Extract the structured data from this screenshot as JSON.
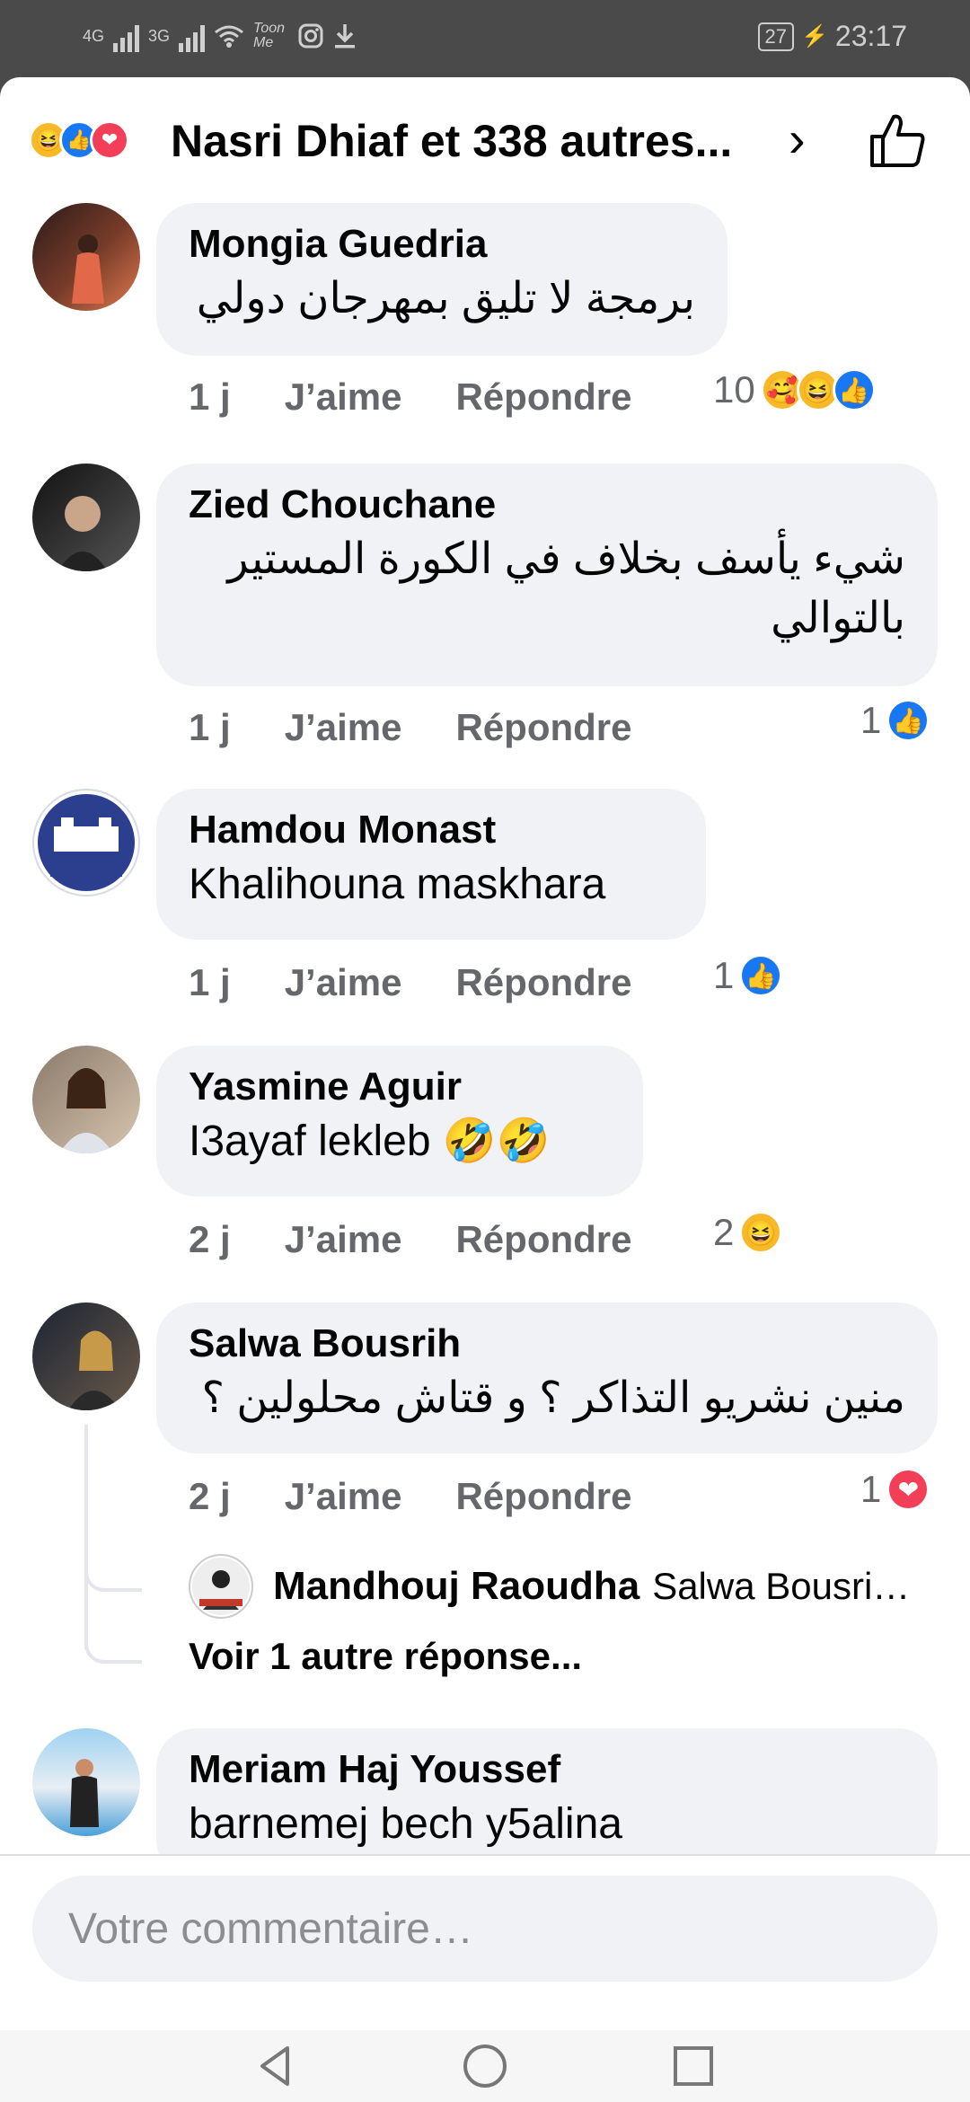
{
  "status_bar": {
    "net1": "4G",
    "net2": "3G",
    "app_label": "Toon Me",
    "battery": "27",
    "time": "23:17"
  },
  "header": {
    "title": "Nasri Dhiaf et 338 autres...",
    "reactions": [
      "haha-icon",
      "like-icon",
      "love-icon"
    ]
  },
  "comments": [
    {
      "name": "Mongia Guedria",
      "text": "برمجة لا تليق بمهرجان دولي",
      "time": "1 j",
      "like": "J’aime",
      "reply": "Répondre",
      "reaction_count": "10",
      "reactions": [
        "care",
        "haha",
        "like"
      ]
    },
    {
      "name": "Zied Chouchane",
      "text": "شيء يأسف بخلاف في الكورة المستير بالتوالي",
      "time": "1 j",
      "like": "J’aime",
      "reply": "Répondre",
      "reaction_count": "1",
      "reactions": [
        "like"
      ]
    },
    {
      "name": "Hamdou Monast",
      "text": "Khalihouna maskhara",
      "time": "1 j",
      "like": "J’aime",
      "reply": "Répondre",
      "reaction_count": "1",
      "reactions": [
        "like"
      ]
    },
    {
      "name": "Yasmine Aguir",
      "text": "I3ayaf lekleb 🤣🤣",
      "time": "2 j",
      "like": "J’aime",
      "reply": "Répondre",
      "reaction_count": "2",
      "reactions": [
        "haha"
      ]
    },
    {
      "name": "Salwa Bousrih",
      "text": "منين نشريو التذاكر ؟ و قتاش محلولين ؟",
      "time": "2 j",
      "like": "J’aime",
      "reply": "Répondre",
      "reaction_count": "1",
      "reactions": [
        "love"
      ],
      "reply_preview": {
        "name": "Mandhouj Raoudha",
        "text": "Salwa Bousri…"
      },
      "more_replies": "Voir 1 autre réponse..."
    },
    {
      "name": "Meriam Haj Youssef",
      "text": "barnemej bech y5alina"
    }
  ],
  "composer": {
    "placeholder": "Votre commentaire…"
  },
  "colors": {
    "like_blue": "#1877f2",
    "love_red": "#f33e58",
    "haha_yellow": "#f7b928",
    "bubble_gray": "#f0f2f5",
    "meta_gray": "#65676b"
  }
}
